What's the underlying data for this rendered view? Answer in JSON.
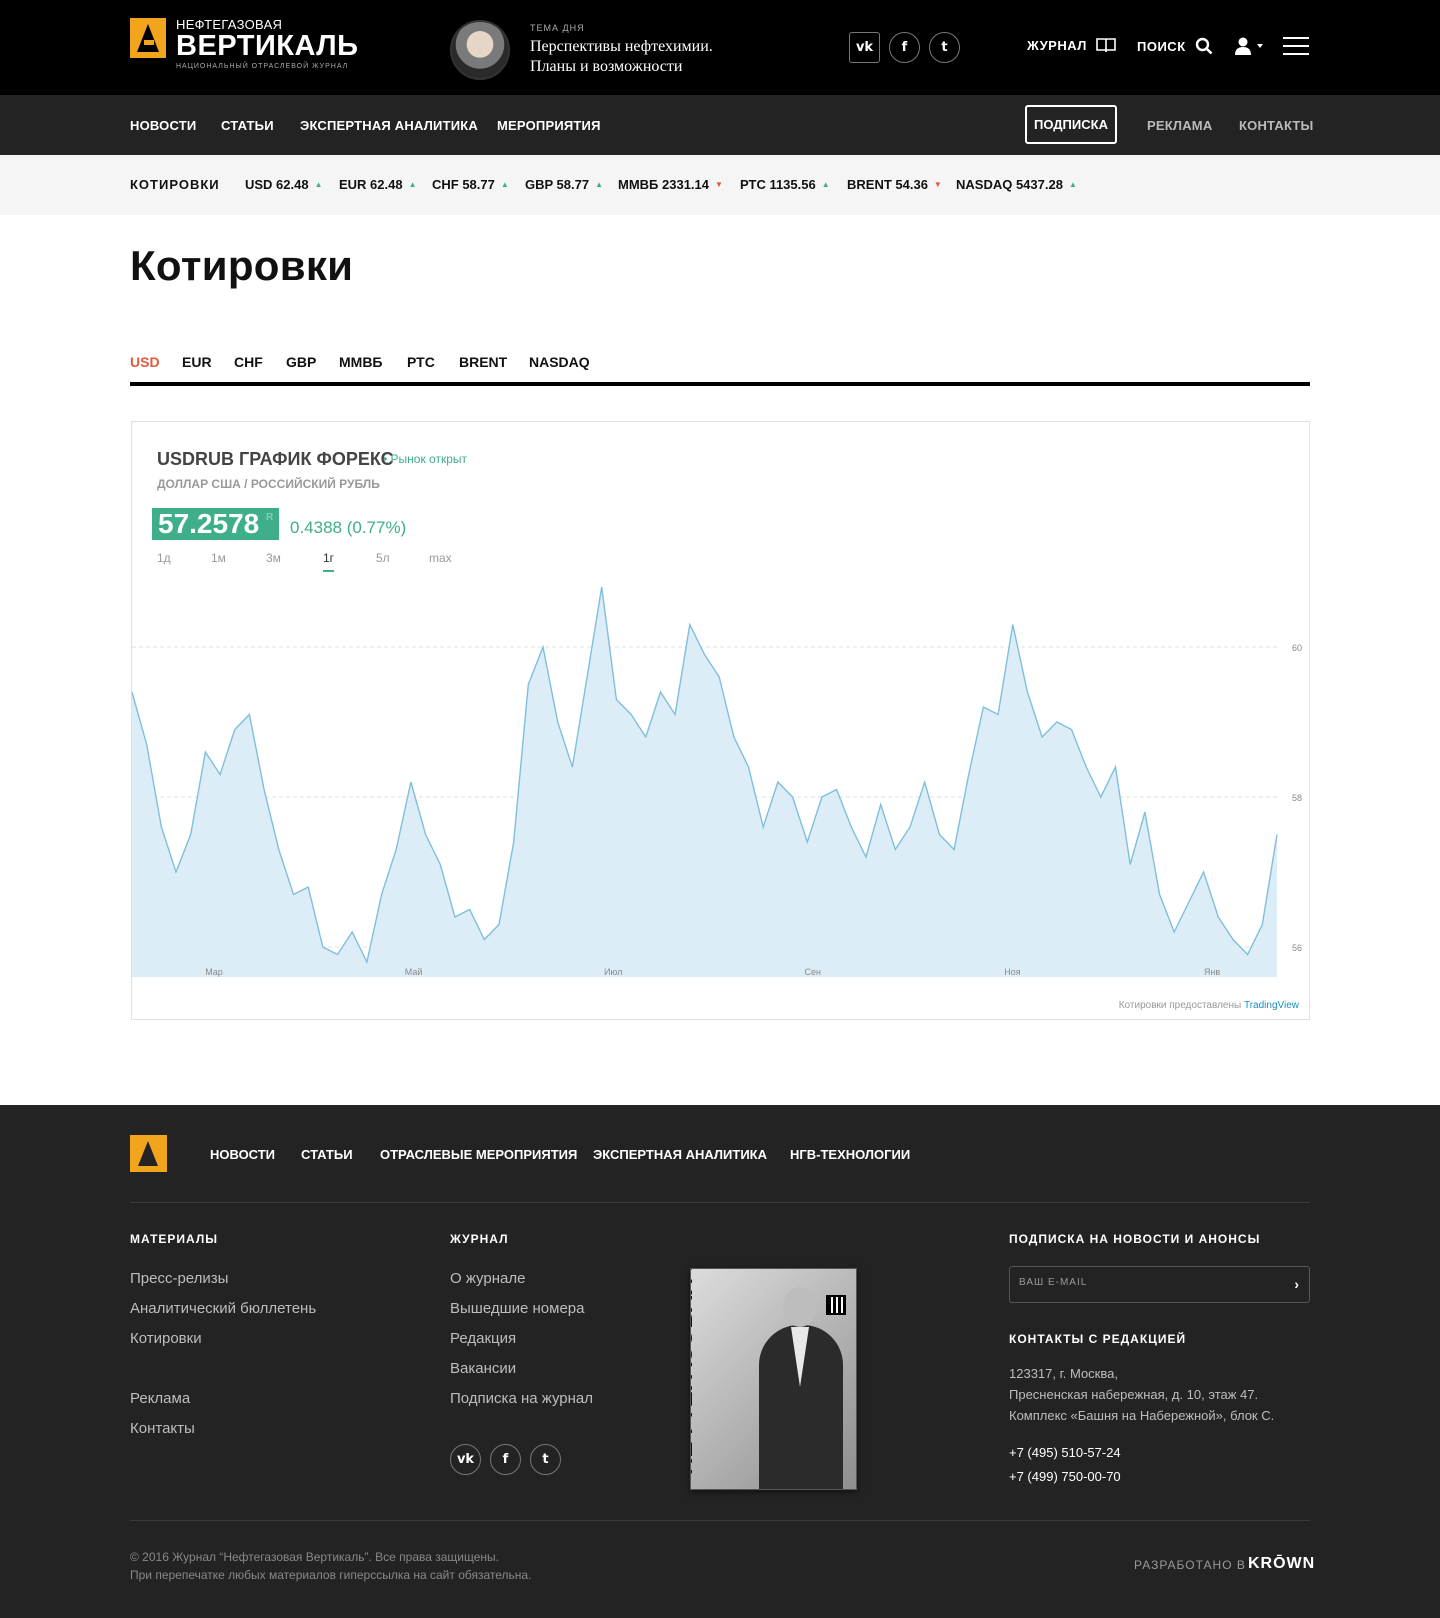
{
  "header": {
    "logo_small": "НЕФТЕГАЗОВАЯ",
    "logo_big": "ВЕРТИКАЛЬ",
    "logo_sub": "национальный отраслевой журнал",
    "topic_label": "ТЕМА ДНЯ",
    "topic_line1": "Перспективы нефтехимии.",
    "topic_line2": "Планы и возможности",
    "social": {
      "vk": "vk",
      "fb": "f",
      "tw": "t"
    },
    "journal_label": "ЖУРНАЛ",
    "search_label": "ПОИСК"
  },
  "nav": {
    "items": [
      "НОВОСТИ",
      "СТАТЬИ",
      "ЭКСПЕРТНАЯ АНАЛИТИКА",
      "МЕРОПРИЯТИЯ"
    ],
    "subscribe": "ПОДПИСКА",
    "ads": "РЕКЛАМА",
    "contacts": "КОНТАКТЫ"
  },
  "ticker": {
    "label": "КОТИРОВКИ",
    "items": [
      {
        "text": "USD 62.48",
        "dir": "up",
        "arrow": "▲"
      },
      {
        "text": "EUR 62.48",
        "dir": "up",
        "arrow": "▲"
      },
      {
        "text": "CHF 58.77",
        "dir": "up",
        "arrow": "▲"
      },
      {
        "text": "GBP 58.77",
        "dir": "up",
        "arrow": "▲"
      },
      {
        "text": "ММВБ 2331.14",
        "dir": "down",
        "arrow": "▼"
      },
      {
        "text": "РТС 1135.56",
        "dir": "up",
        "arrow": "▲"
      },
      {
        "text": "BRENT 54.36",
        "dir": "down",
        "arrow": "▼"
      },
      {
        "text": "NASDAQ 5437.28",
        "dir": "up",
        "arrow": "▲"
      }
    ]
  },
  "page": {
    "title": "Котировки",
    "tabs": [
      "USD",
      "EUR",
      "CHF",
      "GBP",
      "ММВБ",
      "РТС",
      "BRENT",
      "NASDAQ"
    ],
    "active_tab": "USD"
  },
  "widget": {
    "title": "USDRUB ГРАФИК ФОРЕКС",
    "status": "• Рынок открыт",
    "subtitle": "ДОЛЛАР США / РОССИЙСКИЙ РУБЛЬ",
    "price": "57.2578",
    "price_sup": "R",
    "change": "0.4388 (0.77%)",
    "ranges": [
      "1д",
      "1м",
      "3м",
      "1г",
      "5л",
      "max"
    ],
    "active_range": "1г",
    "credit": "Котировки предоставлены ",
    "credit_link": "TradingView"
  },
  "chart_data": {
    "type": "area",
    "x_ticks": [
      "Мар",
      "Май",
      "Июл",
      "Сен",
      "Ноя",
      "Янв"
    ],
    "y_ticks": [
      56,
      58,
      60
    ],
    "ylim": [
      55.6,
      61.0
    ],
    "grid": "horizontal dashed",
    "color": "#7fbfdc",
    "fill": "#dcedf8",
    "series": [
      {
        "values": [
          59.4,
          58.7,
          57.6,
          57.0,
          57.5,
          58.6,
          58.3,
          58.9,
          59.1,
          58.1,
          57.3,
          56.7,
          56.8,
          56.0,
          55.9,
          56.2,
          55.8,
          56.7,
          57.3,
          58.2,
          57.5,
          57.1,
          56.4,
          56.5,
          56.1,
          56.3,
          57.4,
          59.5,
          60.0,
          59.0,
          58.4,
          59.6,
          60.8,
          59.3,
          59.1,
          58.8,
          59.4,
          59.1,
          60.3,
          59.9,
          59.6,
          58.8,
          58.4,
          57.6,
          58.2,
          58.0,
          57.4,
          58.0,
          58.1,
          57.6,
          57.2,
          57.9,
          57.3,
          57.6,
          58.2,
          57.5,
          57.3,
          58.3,
          59.2,
          59.1,
          60.3,
          59.4,
          58.8,
          59.0,
          58.9,
          58.4,
          58.0,
          58.4,
          57.1,
          57.8,
          56.7,
          56.2,
          56.6,
          57.0,
          56.4,
          56.1,
          55.9,
          56.3,
          57.5
        ]
      }
    ]
  },
  "footer": {
    "nav": [
      "НОВОСТИ",
      "СТАТЬИ",
      "ОТРАСЛЕВЫЕ МЕРОПРИЯТИЯ",
      "ЭКСПЕРТНАЯ АНАЛИТИКА",
      "НГВ-ТЕХНОЛОГИИ"
    ],
    "materials_head": "МАТЕРИАЛЫ",
    "materials": [
      "Пресс-релизы",
      "Аналитический бюллетень",
      "Котировки"
    ],
    "materials2": [
      "Реклама",
      "Контакты"
    ],
    "journal_head": "ЖУРНАЛ",
    "journal": [
      "О журнале",
      "Вышедшие номера",
      "Редакция",
      "Вакансии",
      "Подписка на журнал"
    ],
    "cover_title": "НЕФТЕГАЗОВАЯ ВЕРТИКАЛЬ",
    "subscribe_head": "ПОДПИСКА НА НОВОСТИ И АНОНСЫ",
    "email_placeholder": "ВАШ E-MAIL",
    "contacts_head": "КОНТАКТЫ С РЕДАКЦИЕЙ",
    "address": [
      "123317, г. Москва,",
      "Пресненская набережная, д. 10, этаж 47.",
      "Комплекс «Башня на Набережной», блок С."
    ],
    "phones": [
      "+7 (495) 510-57-24",
      "+7 (499) 750-00-70"
    ],
    "copyright": [
      "© 2016 Журнал “Нефтегазовая Вертикаль”. Все права защищены.",
      "При перепечатке любых материалов гиперссылка на сайт обязательна."
    ],
    "dev_label": "РАЗРАБОТАНО В",
    "dev_brand": "KRŌWN"
  }
}
